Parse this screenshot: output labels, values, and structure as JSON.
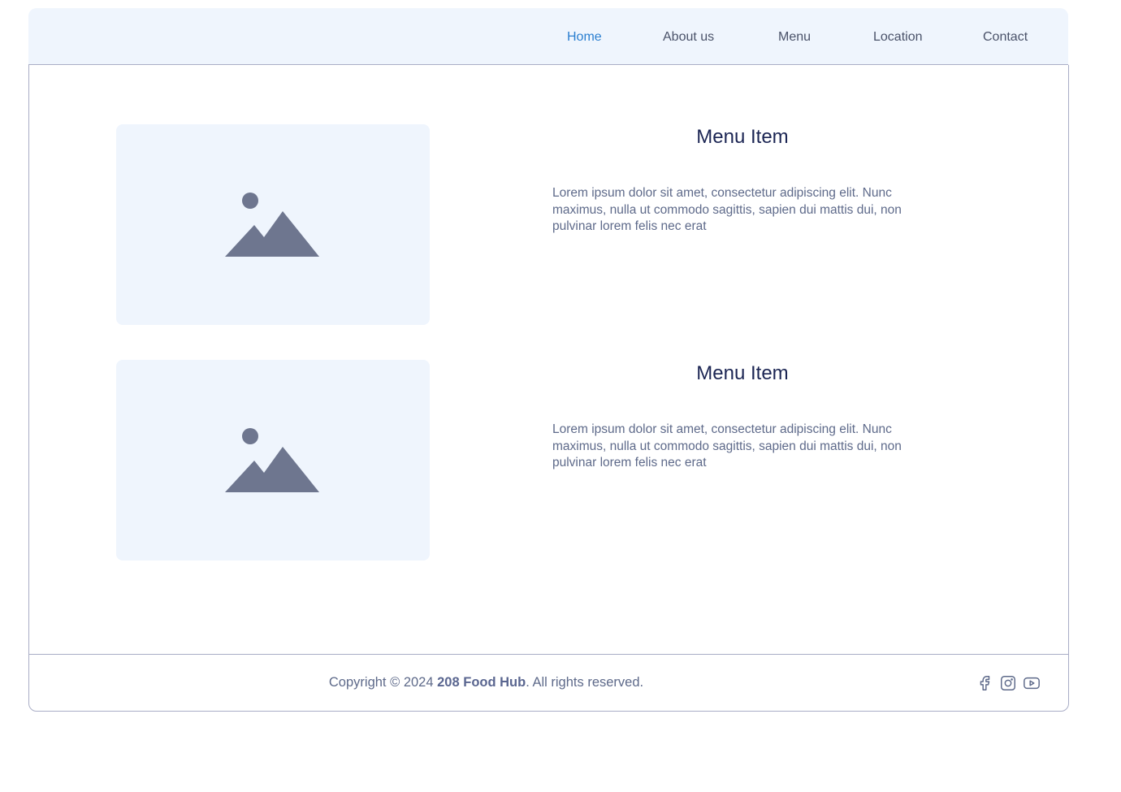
{
  "nav": {
    "items": [
      {
        "label": "Home",
        "active": true
      },
      {
        "label": "About us"
      },
      {
        "label": "Menu"
      },
      {
        "label": "Location"
      },
      {
        "label": "Contact"
      }
    ]
  },
  "menu_items": [
    {
      "title": "Menu Item",
      "description": "Lorem ipsum dolor sit amet, consectetur adipiscing elit. Nunc maximus, nulla ut commodo sagittis, sapien dui mattis dui, non pulvinar lorem felis nec erat",
      "image_icon": "image-placeholder-icon"
    },
    {
      "title": "Menu Item",
      "description": "Lorem ipsum dolor sit amet, consectetur adipiscing elit. Nunc maximus, nulla ut commodo sagittis, sapien dui mattis dui, non pulvinar lorem felis nec erat",
      "image_icon": "image-placeholder-icon"
    }
  ],
  "footer": {
    "copyright_prefix": "Copyright © 2024 ",
    "brand": "208 Food Hub",
    "copyright_suffix": ". All rights reserved.",
    "social": [
      "facebook-icon",
      "instagram-icon",
      "youtube-icon"
    ]
  },
  "colors": {
    "nav_bg": "#eff5fd",
    "active_link": "#2b7fd0",
    "heading": "#1b2553",
    "body_text": "#5e6a8a",
    "placeholder_icon": "#6e768f",
    "border": "#a9adc6"
  }
}
